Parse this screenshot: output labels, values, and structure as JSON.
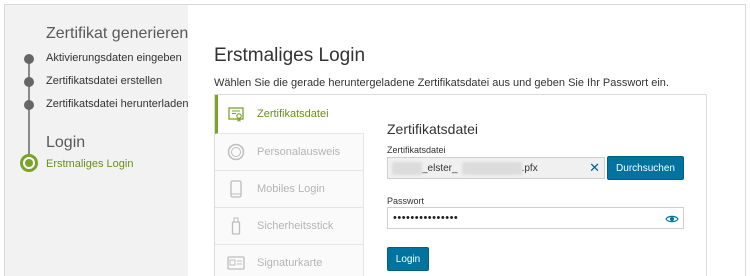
{
  "sidebar": {
    "section1_title": "Zertifikat generieren",
    "steps": [
      {
        "label": "Aktivierungsdaten eingeben"
      },
      {
        "label": "Zertifikatsdatei erstellen"
      },
      {
        "label": "Zertifikatsdatei herunterladen"
      }
    ],
    "section2_title": "Login",
    "active_step": "Erstmaliges Login"
  },
  "main": {
    "title": "Erstmaliges Login",
    "description": "Wählen Sie die gerade heruntergeladene Zertifikatsdatei aus und geben Sie Ihr Passwort ein.",
    "tabs": [
      {
        "label": "Zertifikatsdatei",
        "icon": "certificate-icon",
        "active": true
      },
      {
        "label": "Personalausweis",
        "icon": "id-card-icon",
        "active": false
      },
      {
        "label": "Mobiles Login",
        "icon": "phone-icon",
        "active": false
      },
      {
        "label": "Sicherheitsstick",
        "icon": "usb-stick-icon",
        "active": false
      },
      {
        "label": "Signaturkarte",
        "icon": "signature-card-icon",
        "active": false
      }
    ],
    "form": {
      "title": "Zertifikatsdatei",
      "file_label": "Zertifikatsdatei",
      "file_value_part1": "_elster_",
      "file_value_ext": ".pfx",
      "clear_symbol": "✕",
      "browse_label": "Durchsuchen",
      "password_label": "Passwort",
      "password_value": "•••••••••••••••",
      "login_label": "Login"
    }
  },
  "colors": {
    "accent_green": "#7aa329",
    "button_blue": "#00739f",
    "sidebar_bg": "#f2f2f2"
  }
}
